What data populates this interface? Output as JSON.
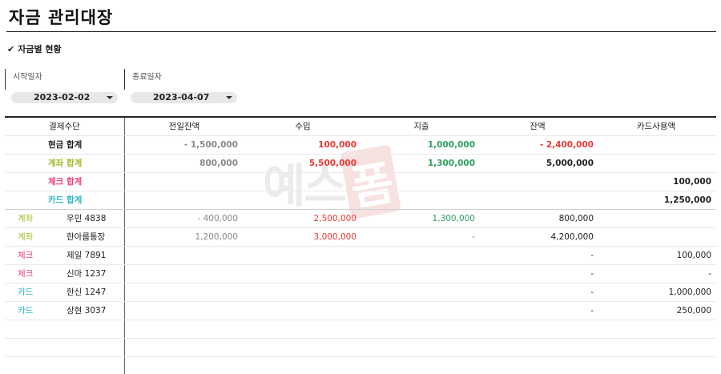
{
  "title": "자금 관리대장",
  "section_label": "자금별 현황",
  "check_icon": "✔",
  "start_date": {
    "label": "시작일자",
    "value": "2023-02-02"
  },
  "end_date": {
    "label": "종료일자",
    "value": "2023-04-07"
  },
  "watermark": {
    "part1": "예스",
    "part2": "폼"
  },
  "colors": {
    "gray": "#888888",
    "red": "#e53935",
    "green": "#2e9e5e",
    "olive": "#a6b82a",
    "pink": "#ec407a",
    "cyan": "#29b6c6",
    "black": "#222222"
  },
  "table": {
    "headers": [
      "결제수단",
      "전일잔액",
      "수입",
      "지출",
      "잔액",
      "카드사용액"
    ],
    "summary": [
      {
        "label": "현금 합계",
        "label_color": "black",
        "prev": "- 1,500,000",
        "income": "100,000",
        "expense": "1,000,000",
        "balance": "- 2,400,000",
        "card": ""
      },
      {
        "label": "계좌 합계",
        "label_color": "olive",
        "prev": "800,000",
        "income": "5,500,000",
        "expense": "1,300,000",
        "balance": "5,000,000",
        "card": ""
      },
      {
        "label": "체크 합계",
        "label_color": "pink",
        "prev": "",
        "income": "",
        "expense": "",
        "balance": "",
        "card": "100,000"
      },
      {
        "label": "카드 합계",
        "label_color": "cyan",
        "prev": "",
        "income": "",
        "expense": "",
        "balance": "",
        "card": "1,250,000"
      }
    ],
    "details": [
      {
        "type": "계좌",
        "type_color": "olive",
        "name": "우민 4838",
        "prev": "- 400,000",
        "income": "2,500,000",
        "expense": "1,300,000",
        "balance": "800,000",
        "card": ""
      },
      {
        "type": "계좌",
        "type_color": "olive",
        "name": "한아름통장",
        "prev": "1,200,000",
        "income": "3,000,000",
        "expense": "-",
        "balance": "4,200,000",
        "card": ""
      },
      {
        "type": "체크",
        "type_color": "pink",
        "name": "제일 7891",
        "prev": "",
        "income": "",
        "expense": "",
        "balance": "-",
        "card": "100,000"
      },
      {
        "type": "체크",
        "type_color": "pink",
        "name": "신마 1237",
        "prev": "",
        "income": "",
        "expense": "",
        "balance": "-",
        "card": "-"
      },
      {
        "type": "카드",
        "type_color": "cyan",
        "name": "한신 1247",
        "prev": "",
        "income": "",
        "expense": "",
        "balance": "-",
        "card": "1,000,000"
      },
      {
        "type": "카드",
        "type_color": "cyan",
        "name": "상현 3037",
        "prev": "",
        "income": "",
        "expense": "",
        "balance": "-",
        "card": "250,000"
      }
    ]
  }
}
